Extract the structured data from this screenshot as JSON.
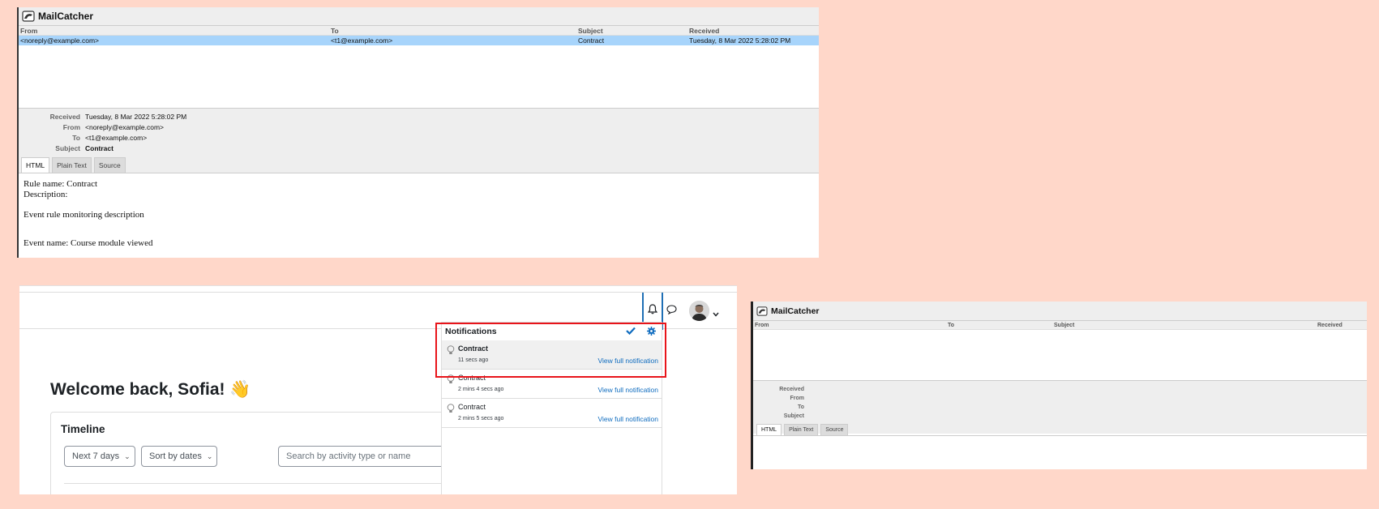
{
  "mailcatcher_main": {
    "app_title": "MailCatcher",
    "columns": [
      "From",
      "To",
      "Subject",
      "Received"
    ],
    "messages": [
      {
        "from": "<noreply@example.com>",
        "to": "<t1@example.com>",
        "subject": "Contract",
        "received": "Tuesday, 8 Mar 2022 5:28:02 PM"
      }
    ],
    "meta": {
      "received_label": "Received",
      "received": "Tuesday, 8 Mar 2022 5:28:02 PM",
      "from_label": "From",
      "from": "<noreply@example.com>",
      "to_label": "To",
      "to": "<t1@example.com>",
      "subject_label": "Subject",
      "subject": "Contract"
    },
    "tabs": [
      "HTML",
      "Plain Text",
      "Source"
    ],
    "active_tab": "HTML",
    "body": {
      "rule_name": "Rule name: Contract",
      "description": "Description:",
      "event_description": "Event rule monitoring description",
      "event_name": "Event name: Course module viewed"
    }
  },
  "mailcatcher_small": {
    "app_title": "MailCatcher",
    "columns": [
      "From",
      "To",
      "Subject",
      "Received"
    ],
    "meta_labels": [
      "Received",
      "From",
      "To",
      "Subject"
    ],
    "tabs": [
      "HTML",
      "Plain Text",
      "Source"
    ],
    "active_tab": "HTML"
  },
  "dashboard": {
    "welcome": "Welcome back, Sofia! 👋",
    "timeline": {
      "title": "Timeline",
      "filter_selected": "Next 7 days",
      "sort_selected": "Sort by dates",
      "search_placeholder": "Search by activity type or name"
    },
    "notifications": {
      "title": "Notifications",
      "items": [
        {
          "subject": "Contract",
          "time": "11 secs ago",
          "link": "View full notification",
          "unread": true
        },
        {
          "subject": "Contract",
          "time": "2 mins 4 secs ago",
          "link": "View full notification",
          "unread": false
        },
        {
          "subject": "Contract",
          "time": "2 mins 5 secs ago",
          "link": "View full notification",
          "unread": false
        }
      ]
    }
  },
  "colors": {
    "background": "#ffd7c9",
    "selected_row": "#a7d4fb",
    "link": "#0f6cbf",
    "highlight": "#e8141a",
    "active_bell_border": "#1f6fb5"
  }
}
